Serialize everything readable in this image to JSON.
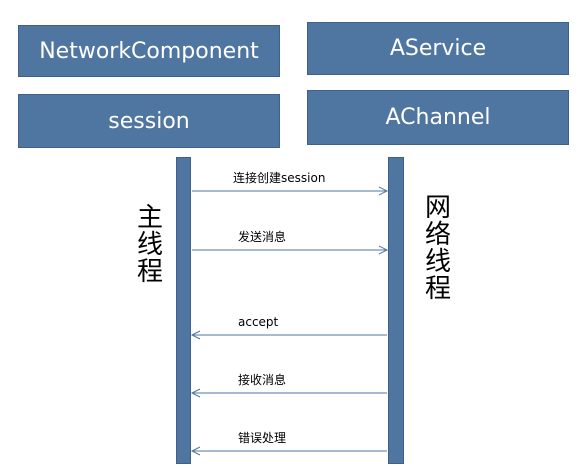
{
  "boxes": {
    "network_component": "NetworkComponent",
    "session": "session",
    "aservice": "AService",
    "achannel": "AChannel"
  },
  "threads": {
    "main": [
      "主",
      "线",
      "程"
    ],
    "network": [
      "网",
      "络",
      "线",
      "程"
    ]
  },
  "messages": [
    {
      "label": "连接创建session",
      "direction": "right"
    },
    {
      "label": "发送消息",
      "direction": "right"
    },
    {
      "label": "accept",
      "direction": "left"
    },
    {
      "label": "接收消息",
      "direction": "left"
    },
    {
      "label": "错误处理",
      "direction": "left"
    }
  ],
  "colors": {
    "box_fill": "#4f76a0",
    "arrow": "#4f76a0"
  }
}
